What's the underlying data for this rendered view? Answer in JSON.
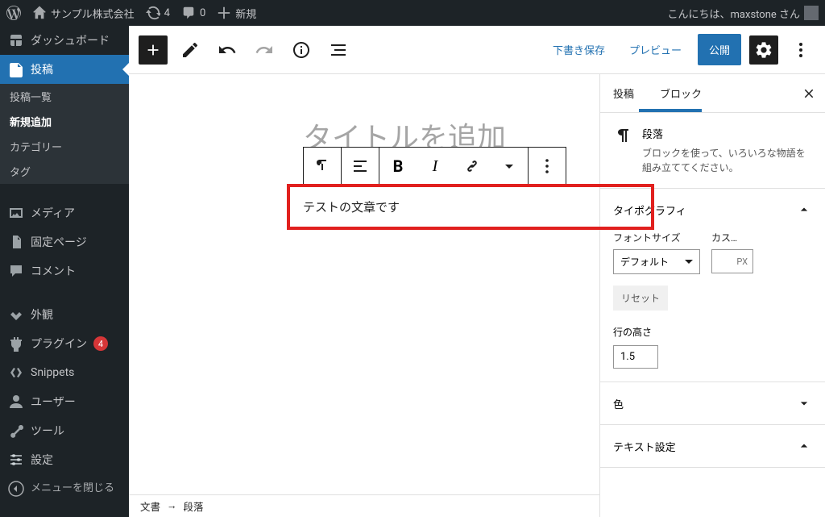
{
  "adminBar": {
    "siteName": "サンプル株式会社",
    "updateCount": "4",
    "commentCount": "0",
    "newLabel": "新規",
    "greeting": "こんにちは、maxstone さん"
  },
  "sidebar": {
    "dashboard": "ダッシュボード",
    "posts": "投稿",
    "postsSub": {
      "all": "投稿一覧",
      "new": "新規追加",
      "categories": "カテゴリー",
      "tags": "タグ"
    },
    "media": "メディア",
    "pages": "固定ページ",
    "comments": "コメント",
    "appearance": "外観",
    "plugins": "プラグイン",
    "pluginUpdates": "4",
    "snippets": "Snippets",
    "users": "ユーザー",
    "tools": "ツール",
    "settings": "設定",
    "collapse": "メニューを閉じる"
  },
  "editorHeader": {
    "saveDraft": "下書き保存",
    "preview": "プレビュー",
    "publish": "公開"
  },
  "canvas": {
    "titlePlaceholder": "タイトルを追加",
    "paragraphText": "テストの文章です",
    "breadcrumbDoc": "文書",
    "breadcrumbArrow": "→",
    "breadcrumbBlock": "段落"
  },
  "inspector": {
    "tabPost": "投稿",
    "tabBlock": "ブロック",
    "blockCard": {
      "title": "段落",
      "desc": "ブロックを使って、いろいろな物語を組み立ててください。"
    },
    "typography": {
      "heading": "タイポグラフィ",
      "fontSizeLabel": "フォントサイズ",
      "customLabel": "カス…",
      "fontSizeValue": "デフォルト",
      "pxUnit": "PX",
      "reset": "リセット",
      "lineHeightLabel": "行の高さ",
      "lineHeightValue": "1.5"
    },
    "color": "色",
    "textSettings": "テキスト設定"
  }
}
